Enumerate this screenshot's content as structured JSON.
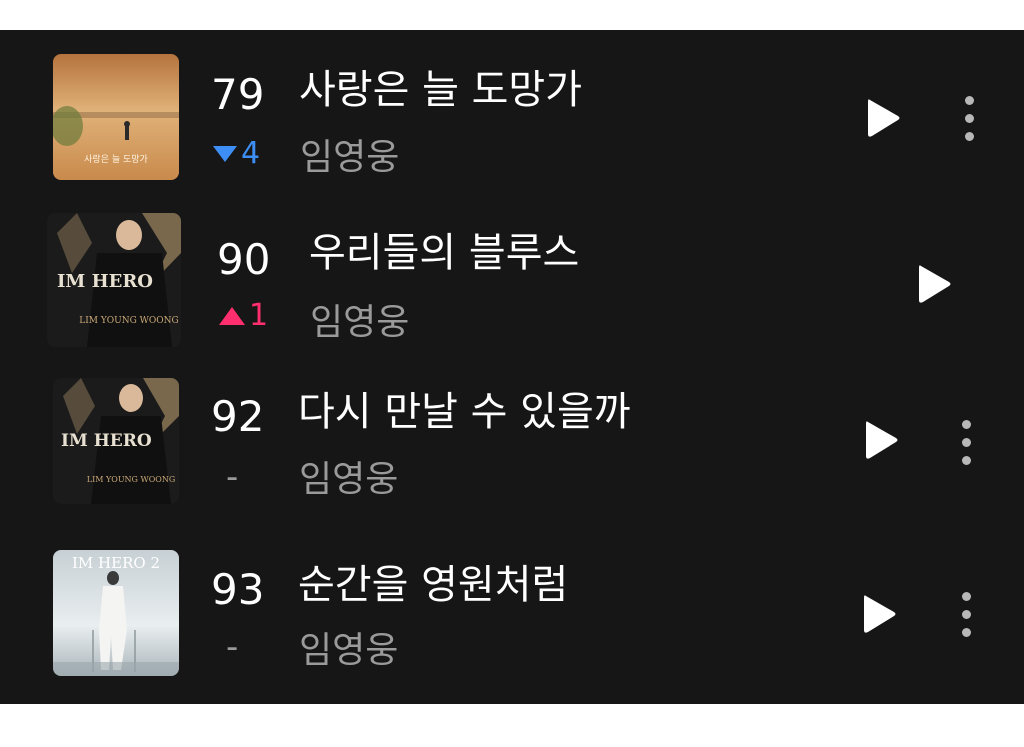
{
  "chart_list": [
    {
      "rank": "79",
      "change": {
        "direction": "down",
        "text": "4"
      },
      "title": "사랑은 늘 도망가",
      "artist": "임영웅",
      "album_art": {
        "caption": "사랑은 늘 도망가",
        "palette": [
          "#c98a4c",
          "#e0b279",
          "#7a5a36"
        ]
      }
    },
    {
      "rank": "90",
      "change": {
        "direction": "up",
        "text": "1"
      },
      "title": "우리들의 블루스",
      "artist": "임영웅",
      "album_art": {
        "caption": "IM HERO",
        "palette": [
          "#1b1b1b",
          "#c9a877",
          "#e8e0d0"
        ]
      }
    },
    {
      "rank": "92",
      "change": {
        "direction": "same",
        "text": "-"
      },
      "title": "다시 만날 수 있을까",
      "artist": "임영웅",
      "album_art": {
        "caption": "IM HERO",
        "palette": [
          "#1b1b1b",
          "#c9a877",
          "#e8e0d0"
        ]
      }
    },
    {
      "rank": "93",
      "change": {
        "direction": "same",
        "text": "-"
      },
      "title": "순간을 영원처럼",
      "artist": "임영웅",
      "album_art": {
        "caption": "IM HERO 2",
        "palette": [
          "#b8c4c8",
          "#e9eef0",
          "#7f8c92"
        ]
      }
    }
  ],
  "icons": {
    "play": "play-icon",
    "more": "more-vertical-icon"
  },
  "colors": {
    "background": "#161616",
    "down": "#3d8ef5",
    "up": "#ff2e6e",
    "muted": "#9a9a9a"
  }
}
